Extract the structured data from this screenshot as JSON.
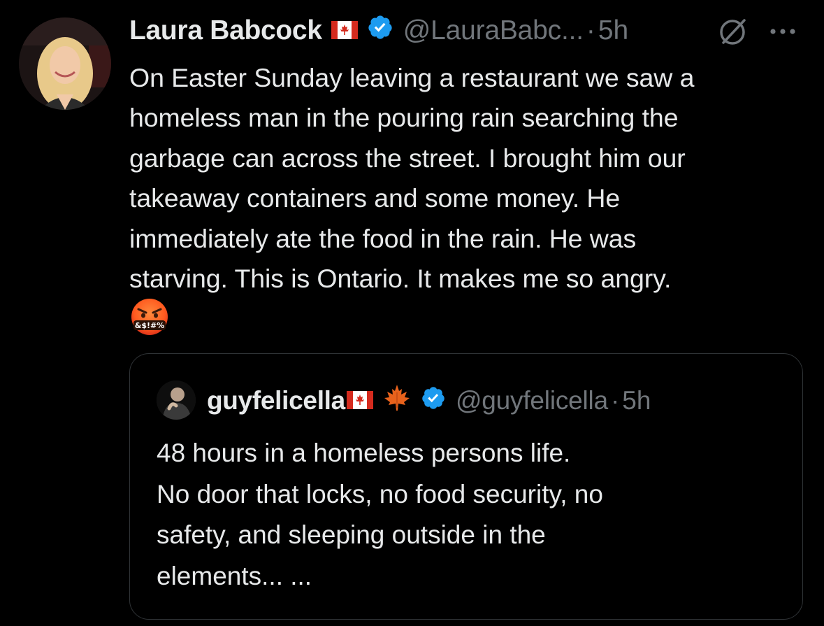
{
  "tweet": {
    "author_name": "Laura Babcock",
    "author_handle": "@LauraBabc...",
    "separator": "·",
    "time": "5h",
    "flag_icon": "canada-flag-icon",
    "verified_icon": "verified-badge-icon",
    "body_lines": [
      "On Easter Sunday leaving a restaurant we saw a",
      "homeless man in the pouring rain searching the",
      "garbage can across the street. I brought him our",
      "takeaway containers and some money. He",
      "immediately ate the food in the rain. He was",
      "starving. This is Ontario. It makes me so angry."
    ],
    "emoji_text": "&$!#%",
    "emoji_icon": "face-with-symbols-on-mouth-icon"
  },
  "quoted": {
    "author_name": "guyfelicella",
    "author_handle": "@guyfelicella",
    "separator": "·",
    "time": "5h",
    "flag_icon": "canada-flag-icon",
    "leaf_icon": "maple-leaf-icon",
    "verified_icon": "verified-badge-icon",
    "body_lines": [
      "48 hours in a homeless persons life.",
      "No door that locks, no food security, no",
      "safety, and sleeping outside in the",
      "elements... ..."
    ]
  },
  "colors": {
    "background": "#000000",
    "primary_text": "#e7e9ea",
    "secondary_text": "#71767b",
    "verified_blue": "#1d9bf0",
    "border": "#2f3336",
    "flag_red": "#d52b1e"
  }
}
